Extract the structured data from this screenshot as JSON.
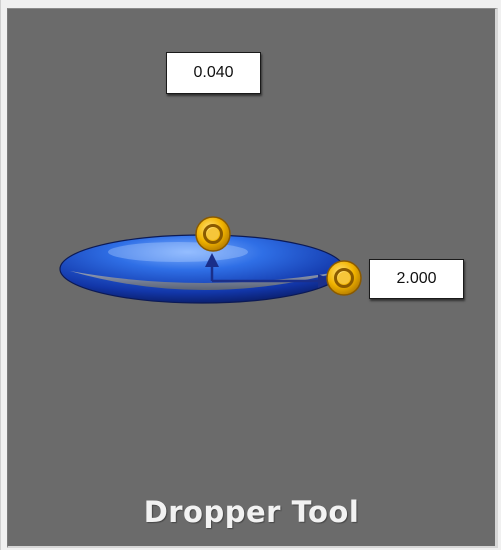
{
  "tool": {
    "name": "Dropper Tool"
  },
  "fields": {
    "top_value": "0.040",
    "right_value": "2.000"
  },
  "colors": {
    "panel_background": "#6b6b6b",
    "drop_blue": "#1f57c7",
    "handle_gold": "#f2a900",
    "label_text": "#f2f2f2"
  },
  "icons": {
    "height_handle": "gold-ring-handle",
    "radius_handle": "gold-ring-handle",
    "center_marker": "arrow-up",
    "radius_arrow": "arrow-right"
  }
}
